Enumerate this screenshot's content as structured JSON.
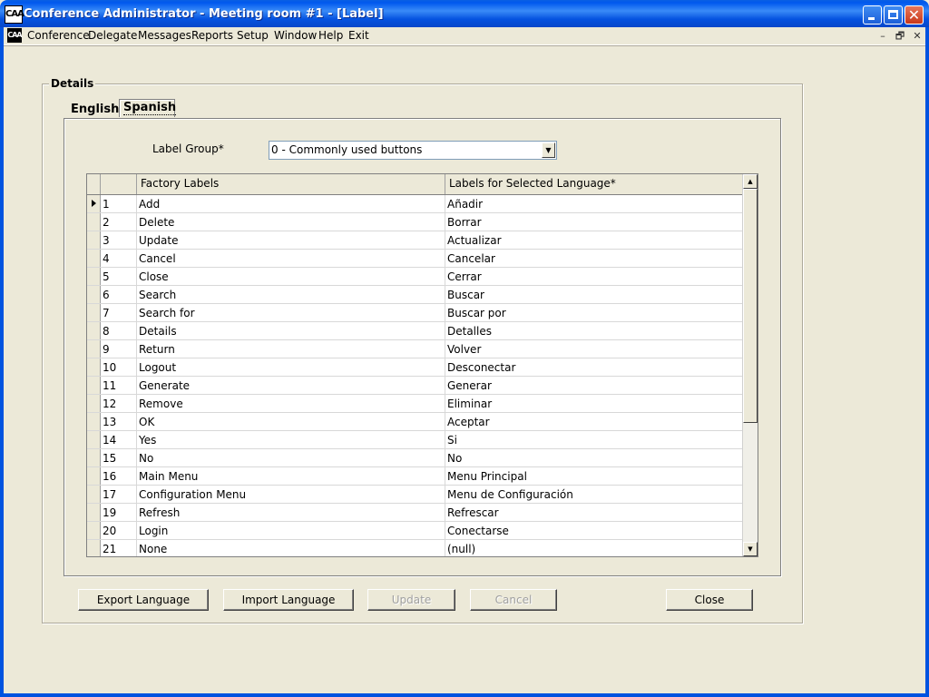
{
  "window": {
    "icon_text": "CAA",
    "title": "Conference Administrator - Meeting room #1 - [Label]",
    "close_glyph": "✕"
  },
  "menubar": {
    "mdi_icon_text": "CAA",
    "items": [
      "Conference",
      "Delegate",
      "Messages",
      "Reports",
      "Setup",
      "Window",
      "Help",
      "Exit"
    ],
    "mdi_controls": [
      "–",
      "🗗",
      "✕"
    ]
  },
  "details": {
    "legend": "Details",
    "tabs": [
      {
        "label": "English",
        "active": false
      },
      {
        "label": "Spanish",
        "active": true
      }
    ],
    "label_group": {
      "label": "Label Group*",
      "value": "0 - Commonly used buttons",
      "dropdown_glyph": "▼"
    }
  },
  "grid": {
    "columns": [
      "",
      "Factory Labels",
      "Labels for Selected Language*"
    ],
    "rows": [
      {
        "num": "1",
        "factory": "Add",
        "lang": "Añadir"
      },
      {
        "num": "2",
        "factory": "Delete",
        "lang": "Borrar"
      },
      {
        "num": "3",
        "factory": "Update",
        "lang": "Actualizar"
      },
      {
        "num": "4",
        "factory": "Cancel",
        "lang": "Cancelar"
      },
      {
        "num": "5",
        "factory": "Close",
        "lang": "Cerrar"
      },
      {
        "num": "6",
        "factory": "Search",
        "lang": "Buscar"
      },
      {
        "num": "7",
        "factory": "Search for",
        "lang": "Buscar por"
      },
      {
        "num": "8",
        "factory": "Details",
        "lang": "Detalles"
      },
      {
        "num": "9",
        "factory": "Return",
        "lang": "Volver"
      },
      {
        "num": "10",
        "factory": "Logout",
        "lang": "Desconectar"
      },
      {
        "num": "11",
        "factory": "Generate",
        "lang": "Generar"
      },
      {
        "num": "12",
        "factory": "Remove",
        "lang": "Eliminar"
      },
      {
        "num": "13",
        "factory": "OK",
        "lang": "Aceptar"
      },
      {
        "num": "14",
        "factory": "Yes",
        "lang": "Si"
      },
      {
        "num": "15",
        "factory": "No",
        "lang": "No"
      },
      {
        "num": "16",
        "factory": "Main Menu",
        "lang": "Menu Principal"
      },
      {
        "num": "17",
        "factory": "Configuration Menu",
        "lang": "Menu de Configuración"
      },
      {
        "num": "19",
        "factory": "Refresh",
        "lang": "Refrescar"
      },
      {
        "num": "20",
        "factory": "Login",
        "lang": "Conectarse"
      },
      {
        "num": "21",
        "factory": "None",
        "lang": "(null)"
      }
    ],
    "scroll_up_glyph": "▲",
    "scroll_down_glyph": "▼"
  },
  "buttons": {
    "export": "Export Language",
    "import": "Import Language",
    "update": "Update",
    "cancel": "Cancel",
    "close": "Close"
  }
}
